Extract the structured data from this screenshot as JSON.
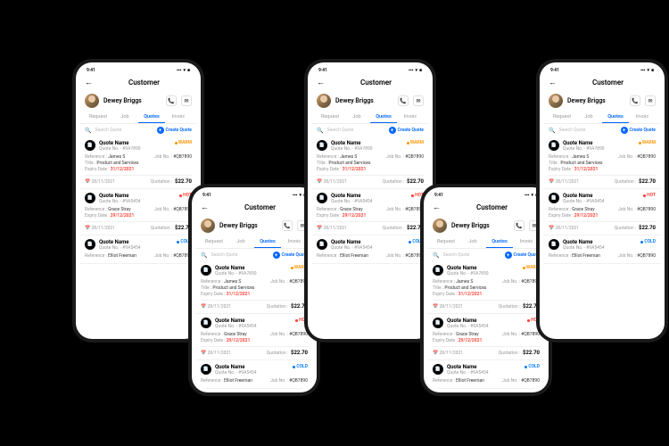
{
  "status": {
    "time": "9:41",
    "signal": "▪▪▪",
    "wifi": "▾",
    "battery": "■"
  },
  "header": {
    "title": "Customer"
  },
  "customer": {
    "name": "Dewey Briggs"
  },
  "tabs": {
    "t1": "Request",
    "t2": "Job",
    "t3": "Quotes",
    "t4": "Invoic"
  },
  "search": {
    "placeholder": "Search Quote",
    "create": "Create Quote"
  },
  "quotes": [
    {
      "name": "Quote Name",
      "no": "Quote No. - #9A7890",
      "status": "WARM",
      "ref": "James S",
      "job": "#QB7890",
      "title": "Product and Services",
      "expiry": "31/12/2021",
      "date": "28/11/2021",
      "amount": "$22.70"
    },
    {
      "name": "Quote Name",
      "no": "Quote No. - #9A5454",
      "status": "HOT",
      "ref": "Grace Stray",
      "job": "#QB7890",
      "title": "",
      "expiry": "29/12/2021",
      "date": "28/11/2021",
      "amount": "$22.70"
    },
    {
      "name": "Quote Name",
      "no": "Quote No. - #9A5454",
      "status": "COLD",
      "ref": "Elliot Freeman",
      "job": "#QB7890",
      "title": "",
      "expiry": "",
      "date": "",
      "amount": ""
    }
  ],
  "labels": {
    "reference": "Reference :",
    "jobno": "Job No. :",
    "title": "Title :",
    "expiry": "Expiry Date :",
    "quotation": "Quotation :"
  }
}
